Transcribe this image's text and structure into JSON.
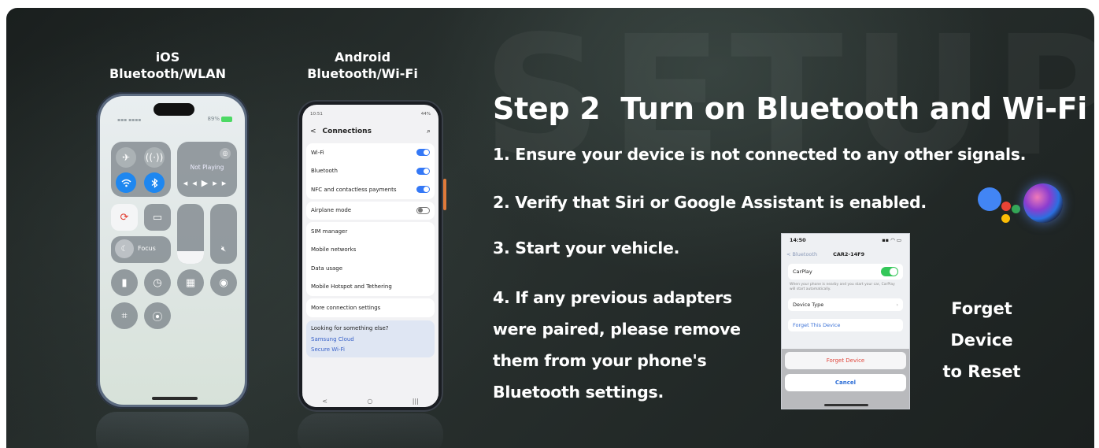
{
  "watermark": "SETUP",
  "ios": {
    "title_line1": "iOS",
    "title_line2": "Bluetooth/WLAN",
    "battery": "89%",
    "media_status": "Not Playing",
    "focus_label": "Focus",
    "icons": [
      "airplane-icon",
      "cellular-icon",
      "wifi-icon",
      "bluetooth-icon",
      "airplay-icon",
      "rotation-lock-icon",
      "screen-mirror-icon",
      "moon-icon",
      "mute-icon",
      "flashlight-icon",
      "timer-icon",
      "calculator-icon",
      "camera-icon",
      "scan-icon",
      "record-icon"
    ]
  },
  "android": {
    "title_line1": "Android",
    "title_line2": "Bluetooth/Wi-Fi",
    "status_time": "10:51",
    "status_batt": "44%",
    "header": "Connections",
    "group1": [
      {
        "label": "Wi-Fi",
        "on": true
      },
      {
        "label": "Bluetooth",
        "on": true
      },
      {
        "label": "NFC and contactless payments",
        "on": true
      }
    ],
    "airplane": {
      "label": "Airplane mode",
      "on": false
    },
    "group2": [
      "SIM manager",
      "Mobile networks",
      "Data usage",
      "Mobile Hotspot and Tethering"
    ],
    "more": "More connection settings",
    "suggest_title": "Looking for something else?",
    "suggest_links": [
      "Samsung Cloud",
      "Secure Wi-Fi"
    ],
    "nav": [
      "<",
      "○",
      "|||"
    ]
  },
  "step": {
    "number": "Step 2",
    "title": "Turn on Bluetooth and Wi-Fi",
    "items": [
      "1.  Ensure your device is not connected to any other signals.",
      "2.  Verify that Siri or Google Assistant is enabled.",
      "3.  Start your vehicle.",
      "4.  If any previous adapters were paired, please remove them from your phone's Bluetooth settings."
    ]
  },
  "forget_screen": {
    "time": "14:50",
    "back": "< Bluetooth",
    "device_name": "CAR2-14F9",
    "carplay": "CarPlay",
    "note": "When your phone is nearby and you start your car, CarPlay will start automatically.",
    "device_type": "Device Type",
    "forget_link": "Forget This Device",
    "forget_button": "Forget Device",
    "cancel_button": "Cancel"
  },
  "forget_label_line1": "Forget Device",
  "forget_label_line2": "to Reset",
  "colors": {
    "accent_blue": "#1e87f0",
    "toggle_on": "#3478f6",
    "toggle_green": "#34c759",
    "destructive": "#e0463b"
  }
}
